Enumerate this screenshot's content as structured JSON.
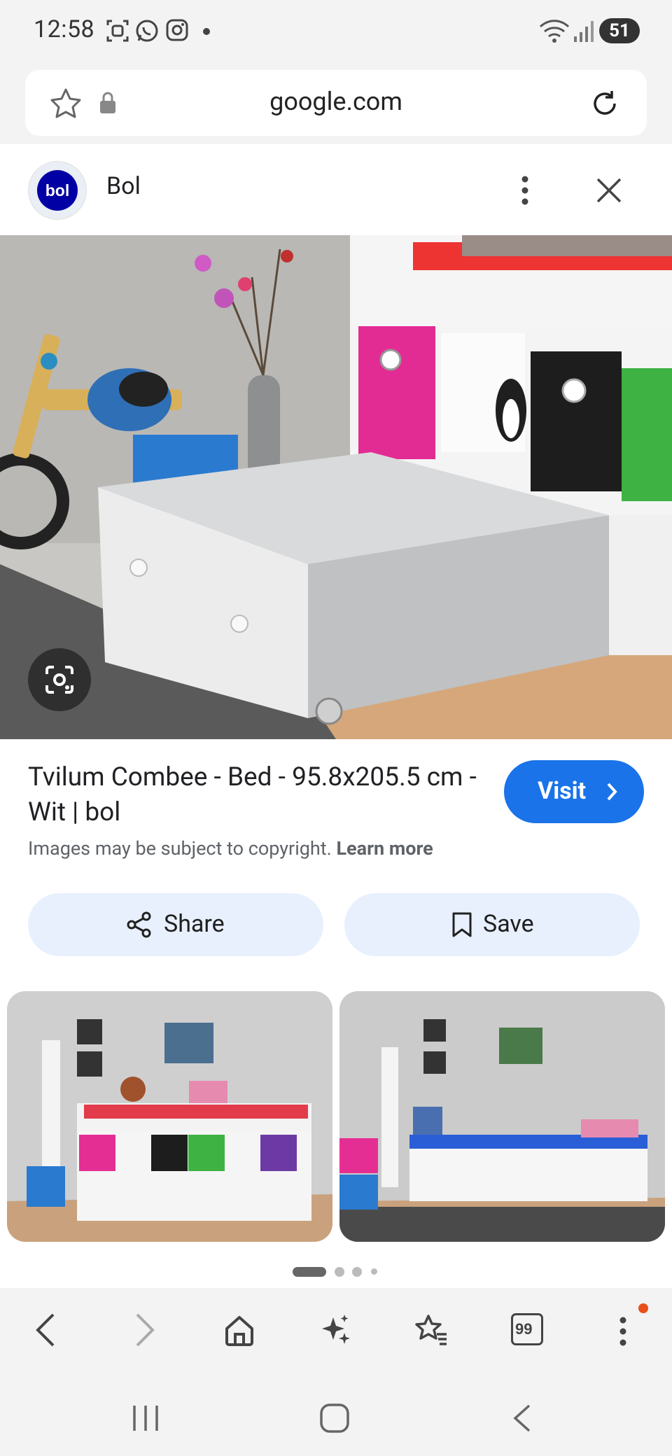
{
  "status_bar": {
    "time": "12:58",
    "battery": "51",
    "icons": [
      "screenshot-icon",
      "whatsapp-icon",
      "instagram-icon",
      "dot-icon",
      "wifi-icon",
      "signal-icon"
    ]
  },
  "browser": {
    "url": "google.com",
    "icons": [
      "star-icon",
      "lock-icon",
      "reload-icon"
    ]
  },
  "sheet": {
    "site_logo_text": "bol",
    "site_name": "Bol",
    "icons": [
      "more-vert-icon",
      "close-icon"
    ]
  },
  "result": {
    "title": "Tvilum Combee - Bed - 95.8x205.5 cm - Wit | bol",
    "visit_label": "Visit",
    "copyright_text": "Images may be subject to copyright.",
    "learn_more": "Learn more",
    "share_label": "Share",
    "save_label": "Save"
  },
  "gallery": {
    "page_count": 4,
    "active_page": 1
  },
  "bottom_toolbar": {
    "items": [
      "back-icon",
      "forward-icon",
      "home-icon",
      "ai-sparkle-icon",
      "bookmarks-icon",
      "tabs-icon",
      "more-vert-icon"
    ],
    "tab_count": "99",
    "notification_color": "#e8501a"
  },
  "system_nav": {
    "items": [
      "recents-icon",
      "home-icon",
      "back-icon"
    ]
  },
  "colors": {
    "accent": "#1a73e8",
    "pill_bg": "#e8f0fe",
    "bol_brand": "#0000a4"
  }
}
